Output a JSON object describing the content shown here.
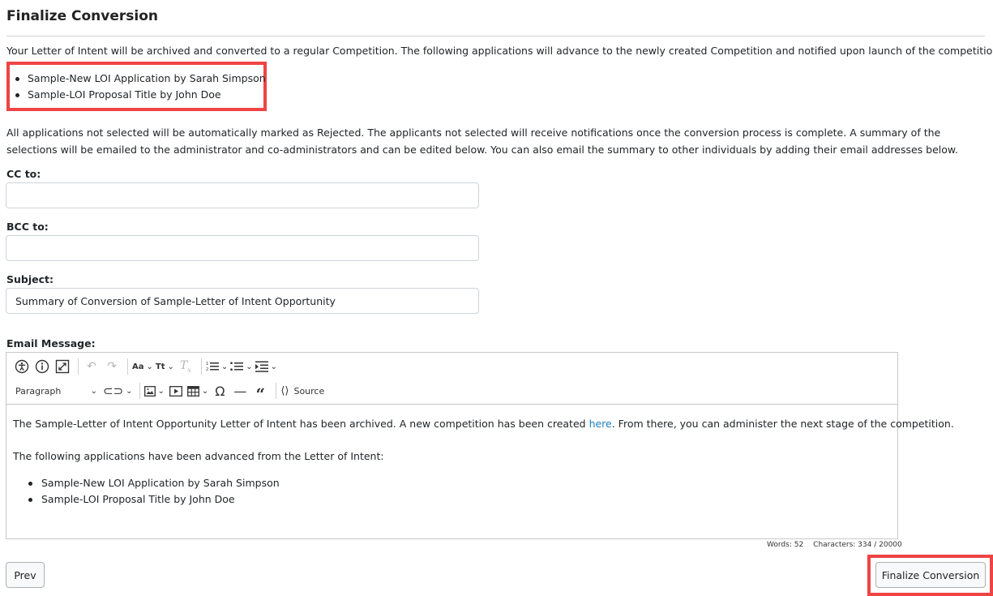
{
  "page": {
    "title": "Finalize Conversion",
    "intro": "Your Letter of Intent will be archived and converted to a regular Competition. The following applications will advance to the newly created Competition and notified upon launch of the competition:",
    "applications": [
      "Sample-New LOI Application by Sarah Simpson",
      "Sample-LOI Proposal Title by John Doe"
    ],
    "notice": "All applications not selected will be automatically marked as Rejected. The applicants not selected will receive notifications once the conversion process is complete. A summary of the selections will be emailed to the administrator and co-administrators and can be edited below. You can also email the summary to other individuals by adding their email addresses below."
  },
  "form": {
    "cc_label": "CC to:",
    "cc_value": "",
    "bcc_label": "BCC to:",
    "bcc_value": "",
    "subject_label": "Subject:",
    "subject_value": "Summary of Conversion of Sample-Letter of Intent Opportunity",
    "message_label": "Email Message:"
  },
  "editor": {
    "toolbar": {
      "font_size_label": "Aa",
      "text_style_label": "Tt",
      "heading_value": "Paragraph",
      "source_label": "Source"
    },
    "content": {
      "line1_before": "The Sample-Letter of Intent Opportunity Letter of Intent has been archived. A new competition has been created ",
      "line1_link": "here",
      "line1_after": ". From there, you can administer the next stage of the competition.",
      "line2": "The following applications have been advanced from the Letter of Intent:",
      "items": [
        "Sample-New LOI Application by Sarah Simpson",
        "Sample-LOI Proposal Title by John Doe"
      ]
    },
    "word_count": "Words: 52",
    "char_count": "Characters: 334 / 20000"
  },
  "actions": {
    "prev_label": "Prev",
    "finalize_label": "Finalize Conversion"
  },
  "colors": {
    "highlight": "#ef4444",
    "link": "#1b7fc0"
  }
}
